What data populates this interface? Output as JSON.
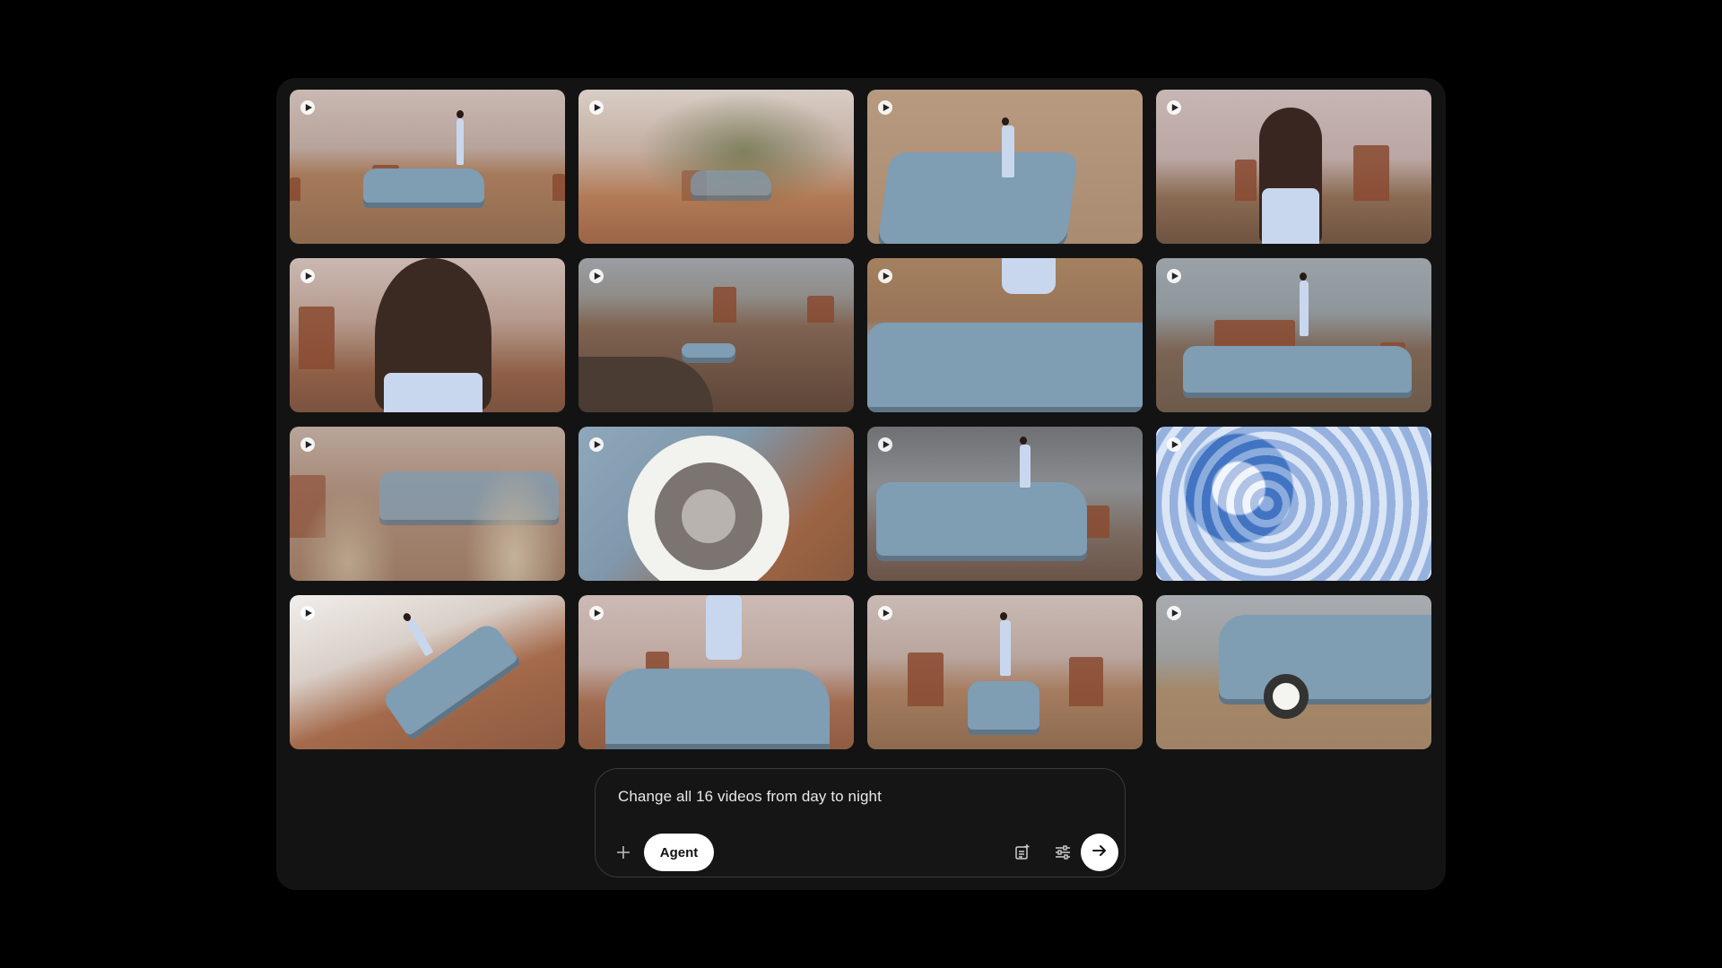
{
  "grid": {
    "videos": [
      {
        "id": 1,
        "icon": "play-icon"
      },
      {
        "id": 2,
        "icon": "play-icon"
      },
      {
        "id": 3,
        "icon": "play-icon"
      },
      {
        "id": 4,
        "icon": "play-icon"
      },
      {
        "id": 5,
        "icon": "play-icon"
      },
      {
        "id": 6,
        "icon": "play-icon"
      },
      {
        "id": 7,
        "icon": "play-icon"
      },
      {
        "id": 8,
        "icon": "play-icon"
      },
      {
        "id": 9,
        "icon": "play-icon"
      },
      {
        "id": 10,
        "icon": "play-icon"
      },
      {
        "id": 11,
        "icon": "play-icon"
      },
      {
        "id": 12,
        "icon": "play-icon"
      },
      {
        "id": 13,
        "icon": "play-icon"
      },
      {
        "id": 14,
        "icon": "play-icon"
      },
      {
        "id": 15,
        "icon": "play-icon"
      },
      {
        "id": 16,
        "icon": "play-icon"
      }
    ]
  },
  "prompt": {
    "text": "Change all 16 videos from day to night",
    "add_icon": "plus-icon",
    "mode_label": "Agent",
    "tool_icons": [
      "document-add-icon",
      "sliders-icon"
    ],
    "send_icon": "arrow-right-icon"
  },
  "colors": {
    "background": "#000000",
    "panel": "#131313",
    "accent_button": "#ffffff",
    "car": "#7f9db3",
    "desert_sand": "#b58a66",
    "butte": "#8a4a30"
  }
}
